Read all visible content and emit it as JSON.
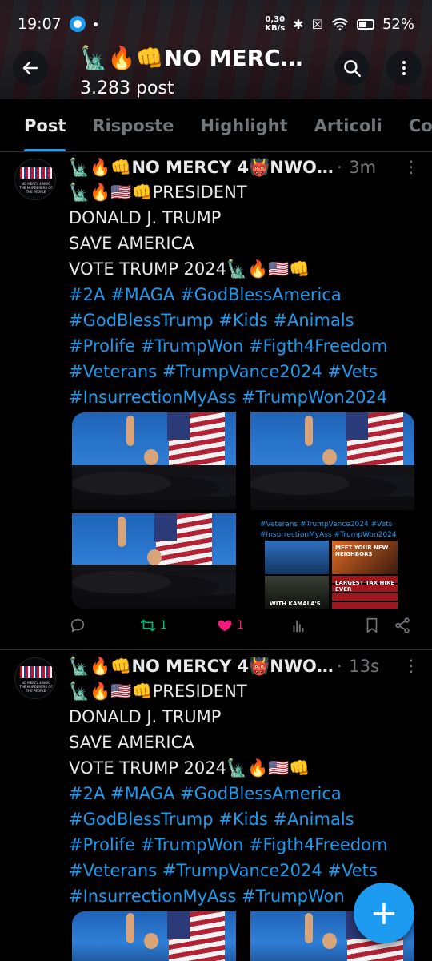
{
  "status_bar": {
    "time": "19:07",
    "speed_value": "0,30",
    "speed_unit": "KB/s",
    "battery": "52%"
  },
  "header": {
    "title": "🗽🔥👊NO MERC…",
    "subtitle": "3.283 post",
    "back_icon": "arrow-left-icon",
    "search_icon": "search-icon",
    "more_icon": "more-vertical-icon"
  },
  "tabs": [
    {
      "label": "Post",
      "active": true
    },
    {
      "label": "Risposte",
      "active": false
    },
    {
      "label": "Highlight",
      "active": false
    },
    {
      "label": "Articoli",
      "active": false
    },
    {
      "label": "Co",
      "active": false
    }
  ],
  "posts": [
    {
      "author": "🗽🔥👊NO MERCY 4👹NWO…",
      "time": "3m",
      "avatar_text": "NO MERCY 4 NWO THE MURDERERS OF THE PEOPLE",
      "lines": [
        "🗽🔥🇺🇸👊PRESIDENT",
        "DONALD J. TRUMP",
        "SAVE AMERICA",
        "VOTE TRUMP 2024🗽🔥🇺🇸👊"
      ],
      "hashtag_lines": [
        "#2A #MAGA #GodBlessAmerica",
        "#GodBlessTrump #Kids #Animals",
        "#Prolife #TrumpWon #Figth4Freedom",
        "#Veterans #TrumpVance2024 #Vets",
        "#InsurrectionMyAss #TrumpWon2024"
      ],
      "collage_text": "#Veterans #TrumpVance2024 #Vets #InsurrectionMyAss #TrumpWon2024",
      "collage_labels": {
        "neighbors": "MEET YOUR NEW NEIGHBORS",
        "kamala": "WITH KAMALA'S",
        "tax": "LARGEST TAX HIKE EVER"
      },
      "reposts": "1",
      "likes": "1"
    },
    {
      "author": "🗽🔥👊NO MERCY 4👹NWO…",
      "time": "13s",
      "avatar_text": "NO MERCY 4 NWO THE MURDERERS OF THE PEOPLE",
      "lines": [
        "🗽🔥🇺🇸👊PRESIDENT",
        "DONALD J. TRUMP",
        "SAVE AMERICA",
        "VOTE TRUMP 2024🗽🔥🇺🇸👊"
      ],
      "hashtag_lines": [
        "#2A #MAGA #GodBlessAmerica",
        "#GodBlessTrump #Kids #Animals",
        "#Prolife #TrumpWon #Figth4Freedom",
        "#Veterans #TrumpVance2024 #Vets",
        "#InsurrectionMyAss #TrumpWon"
      ]
    }
  ],
  "fab": {
    "icon": "plus-icon",
    "label": "+"
  }
}
